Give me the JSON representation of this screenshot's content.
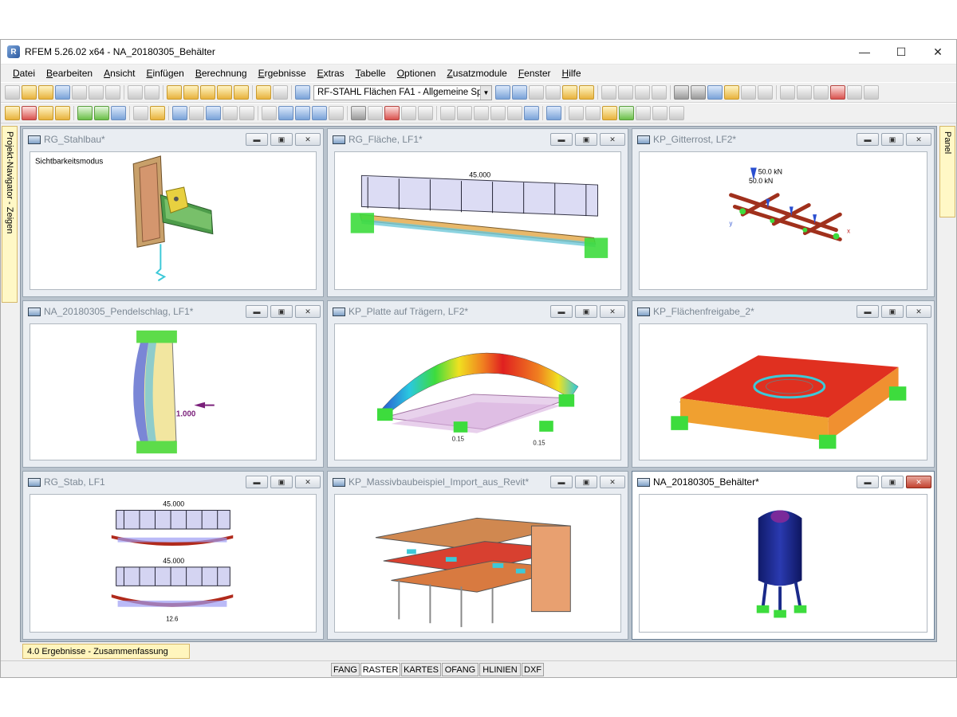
{
  "app": {
    "title": "RFEM 5.26.02 x64 - NA_20180305_Behälter"
  },
  "menu": [
    "Datei",
    "Bearbeiten",
    "Ansicht",
    "Einfügen",
    "Berechnung",
    "Ergebnisse",
    "Extras",
    "Tabelle",
    "Optionen",
    "Zusatzmodule",
    "Fenster",
    "Hilfe"
  ],
  "toolbar": {
    "combo_value": "RF-STAHL Flächen FA1 - Allgemeine Sp"
  },
  "side": {
    "left": "Projekt-Navigator - Zeigen",
    "right": "Panel"
  },
  "windows": [
    {
      "title": "RG_Stahlbau*",
      "overlay": "Sichtbarkeitsmodus"
    },
    {
      "title": "RG_Fläche, LF1*",
      "label": "45.000"
    },
    {
      "title": "KP_Gitterrost, LF2*",
      "label1": "50.0 kN",
      "label2": "50.0 kN"
    },
    {
      "title": "NA_20180305_Pendelschlag, LF1*",
      "label": "1.000"
    },
    {
      "title": "KP_Platte auf Trägern, LF2*",
      "label1": "0.15",
      "label2": "0.15"
    },
    {
      "title": "KP_Flächenfreigabe_2*"
    },
    {
      "title": "RG_Stab, LF1",
      "label1": "45.000",
      "label2": "45.000",
      "label3": "12.6"
    },
    {
      "title": "KP_Massivbaubeispiel_Import_aus_Revit*"
    },
    {
      "title": "NA_20180305_Behälter*"
    }
  ],
  "navigator_tab": "4.0 Ergebnisse - Zusammenfassung",
  "status": [
    "FANG",
    "RASTER",
    "KARTES",
    "OFANG",
    "HLINIEN",
    "DXF"
  ],
  "colors": {
    "accent_yellow": "#fff5bd",
    "close_red": "#c2422f",
    "mdi_bg": "#b9c3cd"
  }
}
